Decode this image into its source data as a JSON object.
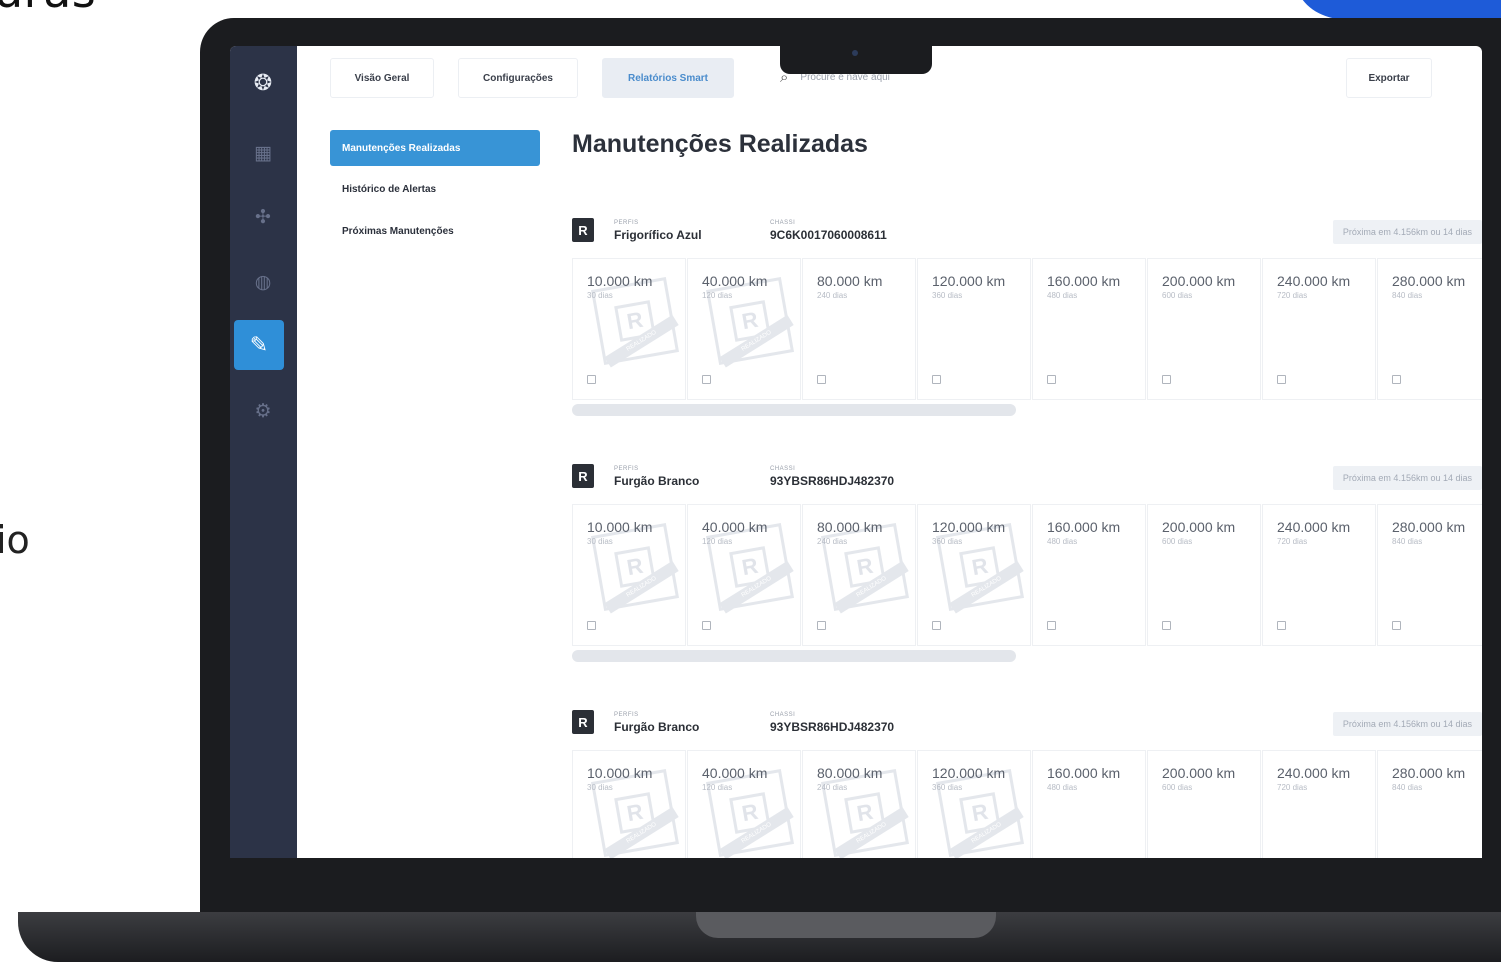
{
  "background": {
    "heading": "uras",
    "fragment": "io",
    "accent_color": "#1e5bd8"
  },
  "app": {
    "rail": {
      "items": [
        {
          "name": "logo-icon",
          "glyph": "❂"
        },
        {
          "name": "dashboard-icon",
          "glyph": "▦"
        },
        {
          "name": "routes-icon",
          "glyph": "✣"
        },
        {
          "name": "globe-icon",
          "glyph": "◍"
        },
        {
          "name": "wrench-icon",
          "glyph": "✎"
        },
        {
          "name": "settings-icon",
          "glyph": "⚙"
        }
      ],
      "active_color": "#2f8fd8"
    },
    "tabs": [
      {
        "label": "Visão Geral",
        "active": false
      },
      {
        "label": "Configurações",
        "active": false
      },
      {
        "label": "Relatórios Smart",
        "active": true
      }
    ],
    "search": {
      "icon": "search-icon",
      "placeholder": "Procure e nave aqui"
    },
    "export_label": "Exportar",
    "submenu": [
      {
        "label": "Manutenções Realizadas",
        "active": true
      },
      {
        "label": "Histórico de Alertas",
        "active": false
      },
      {
        "label": "Próximas Manutenções",
        "active": false
      }
    ],
    "page_title": "Manutenções Realizadas",
    "vehicles": [
      {
        "badge": "R",
        "profile_caption": "PERFIS",
        "profile": "Frigorífico Azul",
        "chassis_caption": "CHASSI",
        "chassis": "9C6K0017060008611",
        "next": "Próxima em 4.156km ou 14 dias",
        "steps": [
          {
            "km": "10.000 km",
            "days": "30 dias",
            "done": true
          },
          {
            "km": "40.000 km",
            "days": "120 dias",
            "done": true
          },
          {
            "km": "80.000 km",
            "days": "240 dias",
            "done": false
          },
          {
            "km": "120.000 km",
            "days": "360 dias",
            "done": false
          },
          {
            "km": "160.000 km",
            "days": "480 dias",
            "done": false
          },
          {
            "km": "200.000 km",
            "days": "600 dias",
            "done": false
          },
          {
            "km": "240.000 km",
            "days": "720 dias",
            "done": false
          },
          {
            "km": "280.000 km",
            "days": "840 dias",
            "done": false
          }
        ]
      },
      {
        "badge": "R",
        "profile_caption": "PERFIS",
        "profile": "Furgão Branco",
        "chassis_caption": "CHASSI",
        "chassis": "93YBSR86HDJ482370",
        "next": "Próxima em 4.156km ou 14 dias",
        "steps": [
          {
            "km": "10.000 km",
            "days": "30 dias",
            "done": true
          },
          {
            "km": "40.000 km",
            "days": "120 dias",
            "done": true
          },
          {
            "km": "80.000 km",
            "days": "240 dias",
            "done": true
          },
          {
            "km": "120.000 km",
            "days": "360 dias",
            "done": true
          },
          {
            "km": "160.000 km",
            "days": "480 dias",
            "done": false
          },
          {
            "km": "200.000 km",
            "days": "600 dias",
            "done": false
          },
          {
            "km": "240.000 km",
            "days": "720 dias",
            "done": false
          },
          {
            "km": "280.000 km",
            "days": "840 dias",
            "done": false
          }
        ]
      },
      {
        "badge": "R",
        "profile_caption": "PERFIS",
        "profile": "Furgão Branco",
        "chassis_caption": "CHASSI",
        "chassis": "93YBSR86HDJ482370",
        "next": "Próxima em 4.156km ou 14 dias",
        "steps": [
          {
            "km": "10.000 km",
            "days": "30 dias",
            "done": true
          },
          {
            "km": "40.000 km",
            "days": "120 dias",
            "done": true
          },
          {
            "km": "80.000 km",
            "days": "240 dias",
            "done": true
          },
          {
            "km": "120.000 km",
            "days": "360 dias",
            "done": true
          },
          {
            "km": "160.000 km",
            "days": "480 dias",
            "done": false
          },
          {
            "km": "200.000 km",
            "days": "600 dias",
            "done": false
          },
          {
            "km": "240.000 km",
            "days": "720 dias",
            "done": false
          },
          {
            "km": "280.000 km",
            "days": "840 dias",
            "done": false
          }
        ]
      }
    ],
    "stamp_text": "REALIZADO"
  }
}
